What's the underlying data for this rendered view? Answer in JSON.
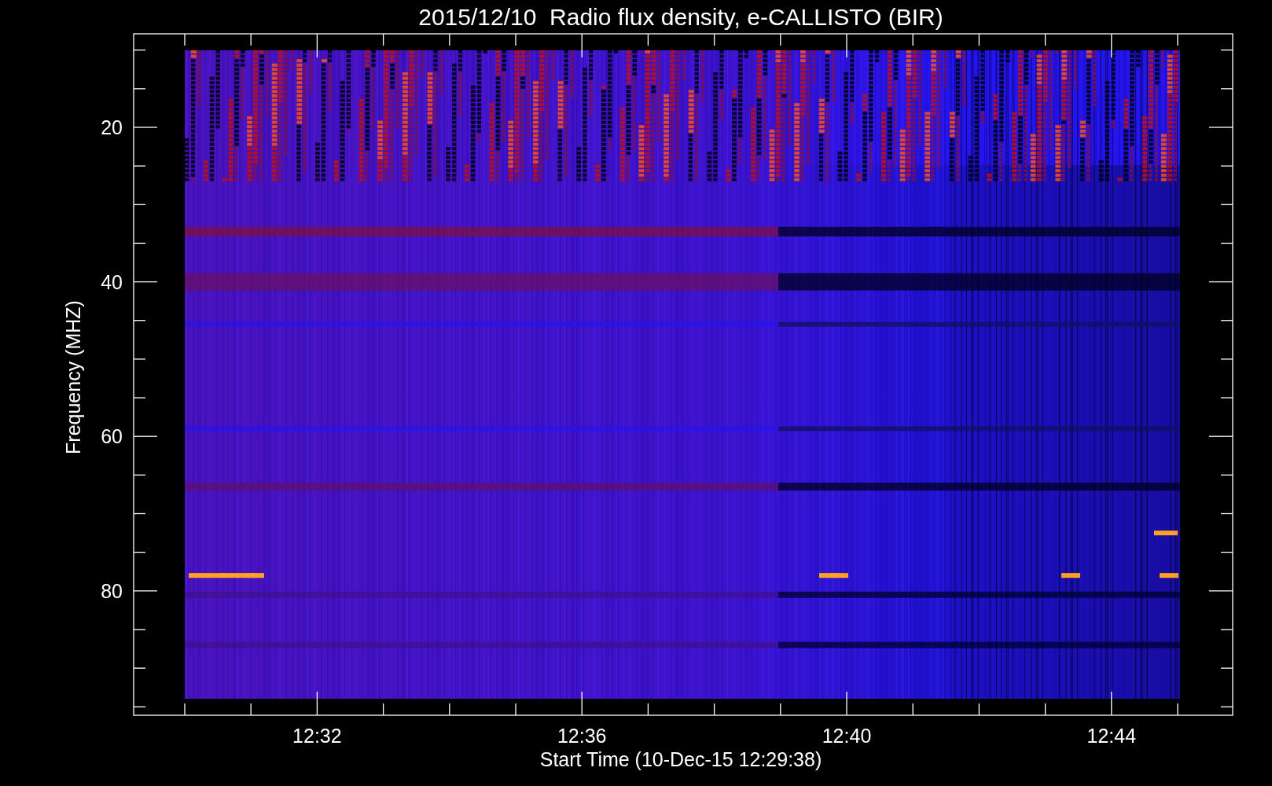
{
  "plot": {
    "title": "2015/12/10  Radio flux density, e-CALLISTO (BIR)",
    "ylabel": "Frequency (MHZ)",
    "xlabel": "Start Time (10-Dec-15 12:29:38)",
    "y_tick_labels": [
      "20",
      "40",
      "60",
      "80"
    ],
    "x_tick_labels": [
      "12:32",
      "12:36",
      "12:40",
      "12:44"
    ]
  }
}
